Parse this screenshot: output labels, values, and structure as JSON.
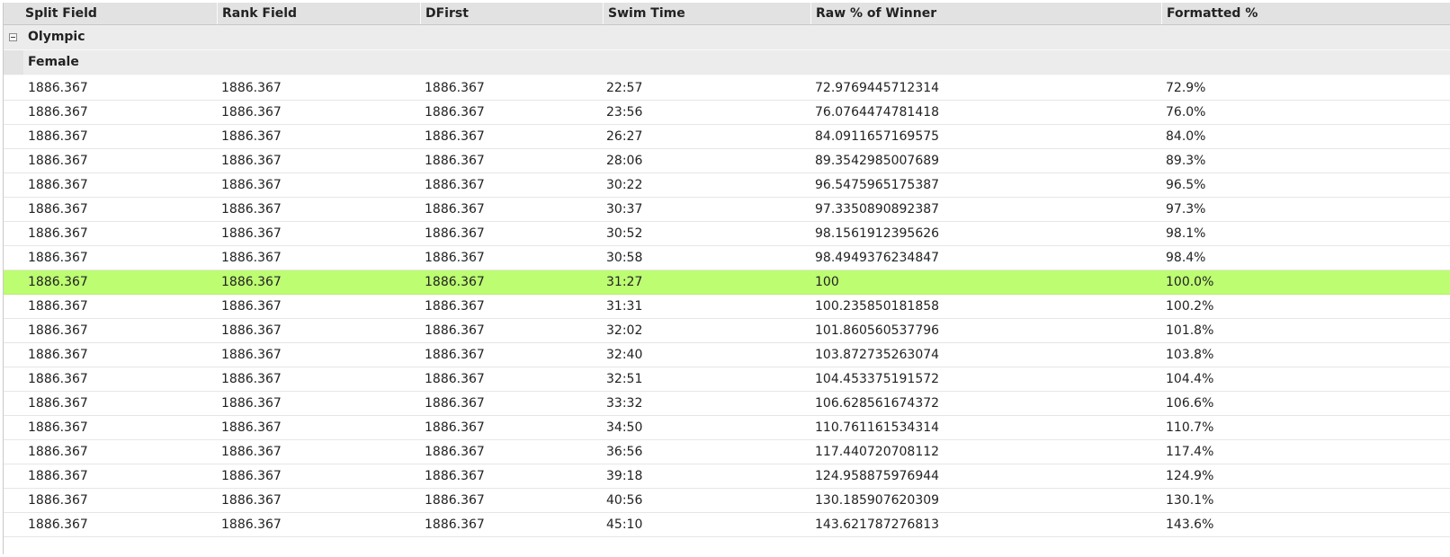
{
  "columns": [
    "Split Field",
    "Rank Field",
    "DFirst",
    "Swim Time",
    "Raw % of Winner",
    "Formatted %"
  ],
  "groups": [
    {
      "label": "Olympic",
      "expanded": true
    },
    {
      "label": "Female"
    }
  ],
  "highlight_color": "#bdfd72",
  "rows": [
    [
      "1886.367",
      "1886.367",
      "1886.367",
      "22:57",
      "72.9769445712314",
      "72.9%"
    ],
    [
      "1886.367",
      "1886.367",
      "1886.367",
      "23:56",
      "76.0764474781418",
      "76.0%"
    ],
    [
      "1886.367",
      "1886.367",
      "1886.367",
      "26:27",
      "84.0911657169575",
      "84.0%"
    ],
    [
      "1886.367",
      "1886.367",
      "1886.367",
      "28:06",
      "89.3542985007689",
      "89.3%"
    ],
    [
      "1886.367",
      "1886.367",
      "1886.367",
      "30:22",
      "96.5475965175387",
      "96.5%"
    ],
    [
      "1886.367",
      "1886.367",
      "1886.367",
      "30:37",
      "97.3350890892387",
      "97.3%"
    ],
    [
      "1886.367",
      "1886.367",
      "1886.367",
      "30:52",
      "98.1561912395626",
      "98.1%"
    ],
    [
      "1886.367",
      "1886.367",
      "1886.367",
      "30:58",
      "98.4949376234847",
      "98.4%"
    ],
    [
      "1886.367",
      "1886.367",
      "1886.367",
      "31:27",
      "100",
      "100.0%"
    ],
    [
      "1886.367",
      "1886.367",
      "1886.367",
      "31:31",
      "100.235850181858",
      "100.2%"
    ],
    [
      "1886.367",
      "1886.367",
      "1886.367",
      "32:02",
      "101.860560537796",
      "101.8%"
    ],
    [
      "1886.367",
      "1886.367",
      "1886.367",
      "32:40",
      "103.872735263074",
      "103.8%"
    ],
    [
      "1886.367",
      "1886.367",
      "1886.367",
      "32:51",
      "104.453375191572",
      "104.4%"
    ],
    [
      "1886.367",
      "1886.367",
      "1886.367",
      "33:32",
      "106.628561674372",
      "106.6%"
    ],
    [
      "1886.367",
      "1886.367",
      "1886.367",
      "34:50",
      "110.761161534314",
      "110.7%"
    ],
    [
      "1886.367",
      "1886.367",
      "1886.367",
      "36:56",
      "117.440720708112",
      "117.4%"
    ],
    [
      "1886.367",
      "1886.367",
      "1886.367",
      "39:18",
      "124.958875976944",
      "124.9%"
    ],
    [
      "1886.367",
      "1886.367",
      "1886.367",
      "40:56",
      "130.185907620309",
      "130.1%"
    ],
    [
      "1886.367",
      "1886.367",
      "1886.367",
      "45:10",
      "143.621787276813",
      "143.6%"
    ]
  ],
  "highlighted_row_index": 8
}
